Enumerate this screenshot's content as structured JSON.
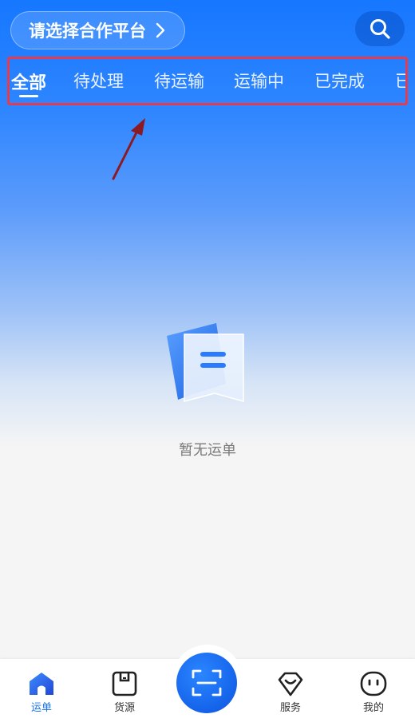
{
  "header": {
    "platform_selector_label": "请选择合作平台",
    "search_icon": "search-icon"
  },
  "tabs": [
    {
      "label": "全部",
      "active": true
    },
    {
      "label": "待处理",
      "active": false
    },
    {
      "label": "待运输",
      "active": false
    },
    {
      "label": "运输中",
      "active": false
    },
    {
      "label": "已完成",
      "active": false
    },
    {
      "label": "已取",
      "active": false
    }
  ],
  "empty_state": {
    "icon": "empty-document-icon",
    "message": "暂无运单"
  },
  "bottom_nav": {
    "items": [
      {
        "label": "运单",
        "icon": "home-icon",
        "active": true
      },
      {
        "label": "货源",
        "icon": "goods-icon",
        "active": false
      },
      {
        "label": "服务",
        "icon": "service-icon",
        "active": false
      },
      {
        "label": "我的",
        "icon": "profile-icon",
        "active": false
      }
    ],
    "scan_icon": "scan-icon"
  },
  "colors": {
    "primary": "#1677ff",
    "annotation_box": "#e33b4f",
    "annotation_arrow": "#8b1a22",
    "active_nav": "#1a73e8"
  }
}
